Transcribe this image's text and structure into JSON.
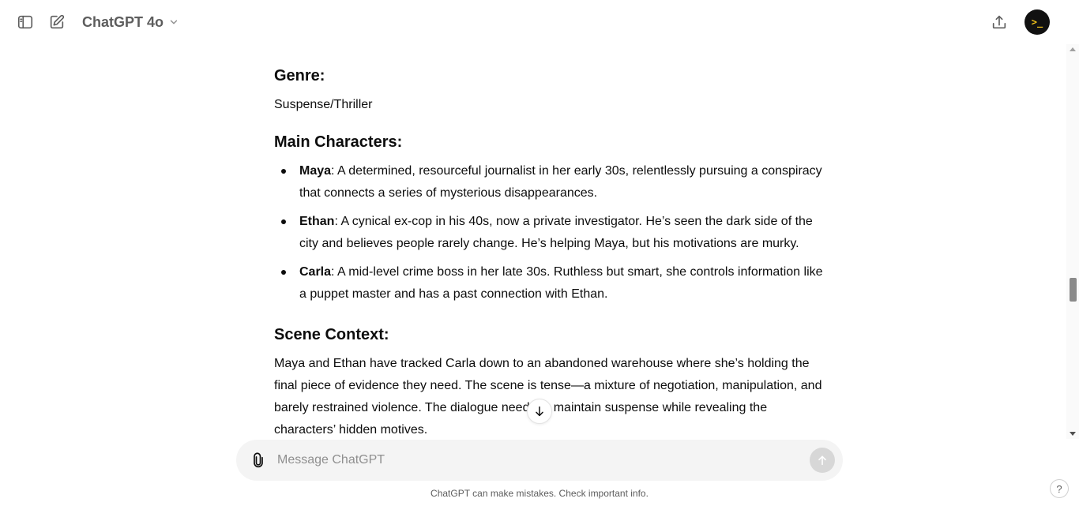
{
  "header": {
    "model_name": "ChatGPT 4o",
    "avatar_text": ">_"
  },
  "message": {
    "sections": {
      "genre_heading": "Genre:",
      "genre_value": "Suspense/Thriller",
      "characters_heading": "Main Characters:",
      "characters": [
        {
          "name": "Maya",
          "description": ": A determined, resourceful journalist in her early 30s, relentlessly pursuing a conspiracy that connects a series of mysterious disappearances."
        },
        {
          "name": "Ethan",
          "description": ": A cynical ex-cop in his 40s, now a private investigator. He’s seen the dark side of the city and believes people rarely change. He’s helping Maya, but his motivations are murky."
        },
        {
          "name": "Carla",
          "description": ": A mid-level crime boss in her late 30s. Ruthless but smart, she controls information like a puppet master and has a past connection with Ethan."
        }
      ],
      "scene_heading": "Scene Context:",
      "scene_text": "Maya and Ethan have tracked Carla down to an abandoned warehouse where she’s holding the final piece of evidence they need. The scene is tense—a mixture of negotiation, manipulation, and barely restrained violence. The dialogue needs to maintain suspense while revealing the characters’ hidden motives."
    }
  },
  "composer": {
    "placeholder": "Message ChatGPT"
  },
  "footer": {
    "disclaimer": "ChatGPT can make mistakes. Check important info.",
    "help_label": "?"
  }
}
